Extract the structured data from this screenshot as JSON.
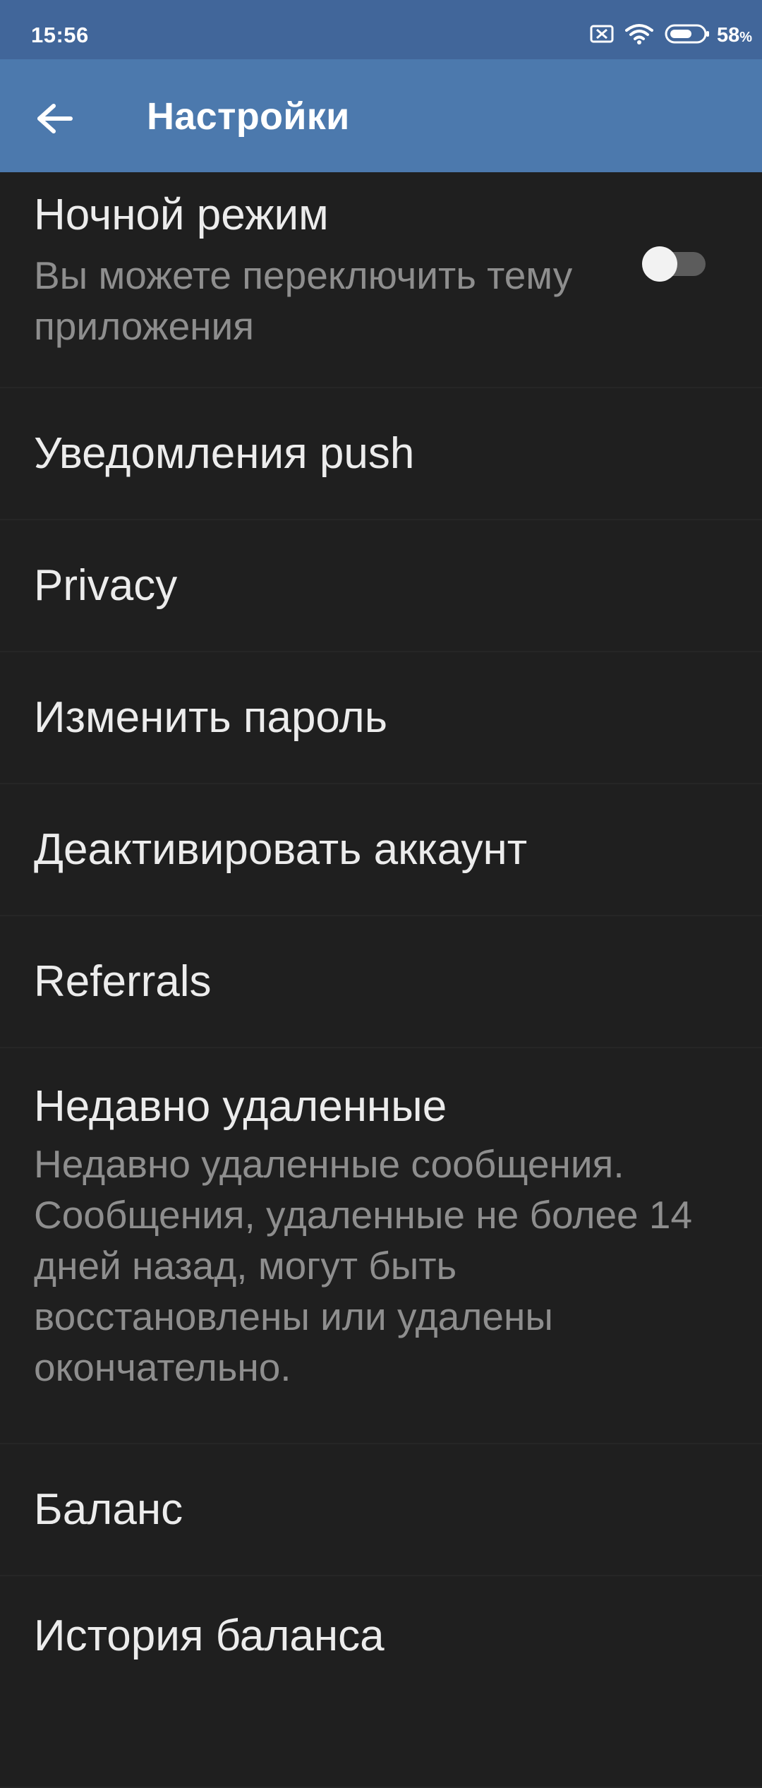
{
  "status_bar": {
    "time": "15:56",
    "battery_percent": "58",
    "battery_percent_sign": "%",
    "battery_level": 0.58,
    "icons": [
      "sim-disabled-icon",
      "wifi-icon",
      "battery-icon"
    ]
  },
  "app_bar": {
    "back_icon": "arrow-back-icon",
    "title": "Настройки"
  },
  "settings": {
    "night_mode": {
      "title": "Ночной режим",
      "subtitle": "Вы можете переключить тему приложения",
      "enabled": false
    },
    "push_notifications": {
      "title": "Уведомления push"
    },
    "privacy": {
      "title": "Privacy"
    },
    "change_password": {
      "title": "Изменить пароль"
    },
    "deactivate_account": {
      "title": "Деактивировать аккаунт"
    },
    "referrals": {
      "title": "Referrals"
    },
    "recently_deleted": {
      "title": "Недавно удаленные",
      "subtitle": "Недавно удаленные сообщения. Сообщения, удаленные не более 14 дней назад, могут быть восстановлены или удалены окончательно."
    },
    "balance": {
      "title": "Баланс"
    },
    "balance_history": {
      "title": "История баланса"
    }
  },
  "colors": {
    "status_bar_bg": "#41669a",
    "app_bar_bg": "#4c79ad",
    "background": "#1f1f1f",
    "title_text": "#ececec",
    "subtitle_text": "#8e8e8e",
    "divider": "#262626",
    "toggle_track": "#5c5c5c",
    "toggle_knob": "#f2f2f2"
  }
}
